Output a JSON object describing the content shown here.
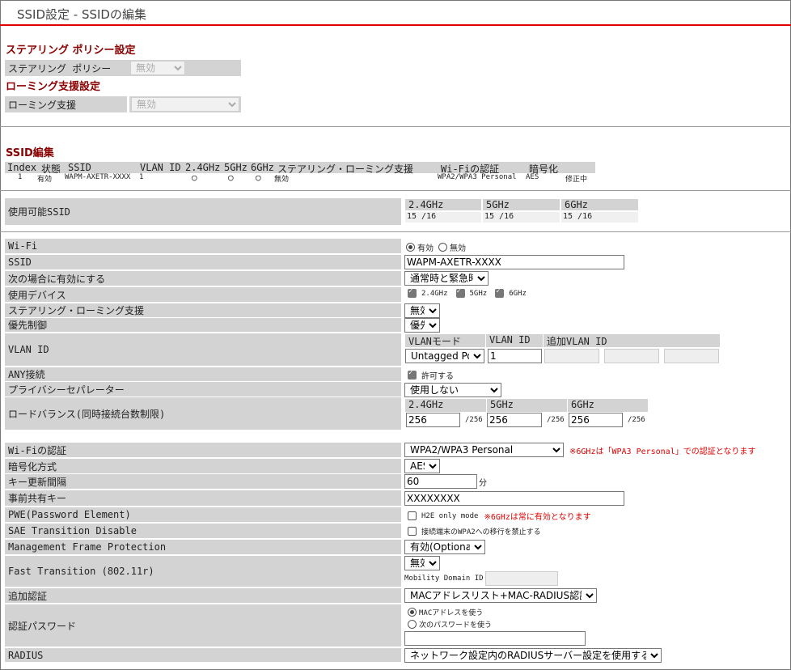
{
  "page_title": "SSID設定 - SSIDの編集",
  "steering_section": {
    "title": "ステアリング ポリシー設定",
    "label": "ステアリング ポリシー",
    "value": "無効"
  },
  "roaming_section": {
    "title": "ローミング支援設定",
    "label": "ローミング支援",
    "value": "無効"
  },
  "ssid_edit": {
    "title": "SSID編集",
    "headers": [
      "Index",
      "状態",
      "SSID",
      "VLAN ID",
      "2.4GHz",
      "5GHz",
      "6GHz",
      "ステアリング・ローミング支援",
      "Wi-Fiの認証",
      "暗号化"
    ],
    "row": {
      "index": "1",
      "status": "有効",
      "ssid": "WAPM-AXETR-XXXX",
      "vlan": "1",
      "g24": "○",
      "g5": "○",
      "g6": "○",
      "steering": "無効",
      "auth": "WPA2/WPA3 Personal",
      "enc": "AES",
      "state": "修正中"
    }
  },
  "available": {
    "label": "使用可能SSID",
    "cols": [
      {
        "band": "2.4GHz",
        "count": "15 /16"
      },
      {
        "band": "5GHz",
        "count": "15 /16"
      },
      {
        "band": "6GHz",
        "count": "15 /16"
      }
    ]
  },
  "form": {
    "wifi_label": "Wi-Fi",
    "wifi_on": "有効",
    "wifi_off": "無効",
    "ssid_label": "SSID",
    "ssid_value": "WAPM-AXETR-XXXX",
    "enable_label": "次の場合に有効にする",
    "enable_value": "通常時と緊急時",
    "devices_label": "使用デバイス",
    "dev_24": "2.4GHz",
    "dev_5": "5GHz",
    "dev_6": "6GHz",
    "steering_label": "ステアリング・ローミング支援",
    "steering_value": "無効",
    "priority_label": "優先制御",
    "priority_value": "優先",
    "vlan_label": "VLAN ID",
    "vlan_mode_h": "VLANモード",
    "vlan_id_h": "VLAN ID",
    "vlan_add_h": "追加VLAN ID",
    "vlan_mode_value": "Untagged Port",
    "vlan_id_value": "1",
    "any_label": "ANY接続",
    "any_value": "許可する",
    "privacy_label": "プライバシーセパレーター",
    "privacy_value": "使用しない",
    "lb_label": "ロードバランス(同時接続台数制限)",
    "lb_cols": [
      {
        "band": "2.4GHz",
        "value": "256",
        "max": "/256"
      },
      {
        "band": "5GHz",
        "value": "256",
        "max": "/256"
      },
      {
        "band": "6GHz",
        "value": "256",
        "max": "/256"
      }
    ],
    "auth_label": "Wi-Fiの認証",
    "auth_value": "WPA2/WPA3 Personal",
    "auth_note": "※6GHzは「WPA3 Personal」での認証となります",
    "enc_label": "暗号化方式",
    "enc_value": "AES",
    "key_interval_label": "キー更新間隔",
    "key_interval_value": "60",
    "key_interval_unit": "分",
    "psk_label": "事前共有キー",
    "psk_value": "XXXXXXXX",
    "pwe_label": "PWE(Password Element)",
    "pwe_value": "H2E only mode",
    "pwe_note": "※6GHzは常に有効となります",
    "sae_label": "SAE Transition Disable",
    "sae_value": "接続端末のWPA2への移行を禁止する",
    "mfp_label": "Management Frame Protection",
    "mfp_value": "有効(Optional)",
    "ft_label": "Fast Transition (802.11r)",
    "ft_value": "無効",
    "mdid_label": "Mobility Domain ID",
    "add_auth_label": "追加認証",
    "add_auth_value": "MACアドレスリスト+MAC-RADIUS認証",
    "auth_pw_label": "認証パスワード",
    "auth_pw_opt1": "MACアドレスを使う",
    "auth_pw_opt2": "次のパスワードを使う",
    "radius_label": "RADIUS",
    "radius_value": "ネットワーク設定内のRADIUSサーバー設定を使用する"
  }
}
